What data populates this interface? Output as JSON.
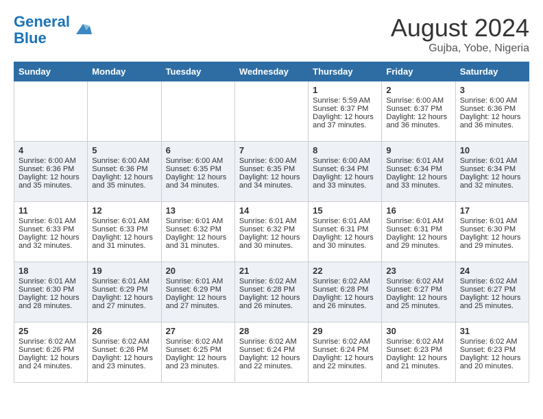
{
  "header": {
    "logo_line1": "General",
    "logo_line2": "Blue",
    "month_title": "August 2024",
    "location": "Gujba, Yobe, Nigeria"
  },
  "weekdays": [
    "Sunday",
    "Monday",
    "Tuesday",
    "Wednesday",
    "Thursday",
    "Friday",
    "Saturday"
  ],
  "weeks": [
    [
      {
        "day": "",
        "content": ""
      },
      {
        "day": "",
        "content": ""
      },
      {
        "day": "",
        "content": ""
      },
      {
        "day": "",
        "content": ""
      },
      {
        "day": "1",
        "content": "Sunrise: 5:59 AM\nSunset: 6:37 PM\nDaylight: 12 hours\nand 37 minutes."
      },
      {
        "day": "2",
        "content": "Sunrise: 6:00 AM\nSunset: 6:37 PM\nDaylight: 12 hours\nand 36 minutes."
      },
      {
        "day": "3",
        "content": "Sunrise: 6:00 AM\nSunset: 6:36 PM\nDaylight: 12 hours\nand 36 minutes."
      }
    ],
    [
      {
        "day": "4",
        "content": "Sunrise: 6:00 AM\nSunset: 6:36 PM\nDaylight: 12 hours\nand 35 minutes."
      },
      {
        "day": "5",
        "content": "Sunrise: 6:00 AM\nSunset: 6:36 PM\nDaylight: 12 hours\nand 35 minutes."
      },
      {
        "day": "6",
        "content": "Sunrise: 6:00 AM\nSunset: 6:35 PM\nDaylight: 12 hours\nand 34 minutes."
      },
      {
        "day": "7",
        "content": "Sunrise: 6:00 AM\nSunset: 6:35 PM\nDaylight: 12 hours\nand 34 minutes."
      },
      {
        "day": "8",
        "content": "Sunrise: 6:00 AM\nSunset: 6:34 PM\nDaylight: 12 hours\nand 33 minutes."
      },
      {
        "day": "9",
        "content": "Sunrise: 6:01 AM\nSunset: 6:34 PM\nDaylight: 12 hours\nand 33 minutes."
      },
      {
        "day": "10",
        "content": "Sunrise: 6:01 AM\nSunset: 6:34 PM\nDaylight: 12 hours\nand 32 minutes."
      }
    ],
    [
      {
        "day": "11",
        "content": "Sunrise: 6:01 AM\nSunset: 6:33 PM\nDaylight: 12 hours\nand 32 minutes."
      },
      {
        "day": "12",
        "content": "Sunrise: 6:01 AM\nSunset: 6:33 PM\nDaylight: 12 hours\nand 31 minutes."
      },
      {
        "day": "13",
        "content": "Sunrise: 6:01 AM\nSunset: 6:32 PM\nDaylight: 12 hours\nand 31 minutes."
      },
      {
        "day": "14",
        "content": "Sunrise: 6:01 AM\nSunset: 6:32 PM\nDaylight: 12 hours\nand 30 minutes."
      },
      {
        "day": "15",
        "content": "Sunrise: 6:01 AM\nSunset: 6:31 PM\nDaylight: 12 hours\nand 30 minutes."
      },
      {
        "day": "16",
        "content": "Sunrise: 6:01 AM\nSunset: 6:31 PM\nDaylight: 12 hours\nand 29 minutes."
      },
      {
        "day": "17",
        "content": "Sunrise: 6:01 AM\nSunset: 6:30 PM\nDaylight: 12 hours\nand 29 minutes."
      }
    ],
    [
      {
        "day": "18",
        "content": "Sunrise: 6:01 AM\nSunset: 6:30 PM\nDaylight: 12 hours\nand 28 minutes."
      },
      {
        "day": "19",
        "content": "Sunrise: 6:01 AM\nSunset: 6:29 PM\nDaylight: 12 hours\nand 27 minutes."
      },
      {
        "day": "20",
        "content": "Sunrise: 6:01 AM\nSunset: 6:29 PM\nDaylight: 12 hours\nand 27 minutes."
      },
      {
        "day": "21",
        "content": "Sunrise: 6:02 AM\nSunset: 6:28 PM\nDaylight: 12 hours\nand 26 minutes."
      },
      {
        "day": "22",
        "content": "Sunrise: 6:02 AM\nSunset: 6:28 PM\nDaylight: 12 hours\nand 26 minutes."
      },
      {
        "day": "23",
        "content": "Sunrise: 6:02 AM\nSunset: 6:27 PM\nDaylight: 12 hours\nand 25 minutes."
      },
      {
        "day": "24",
        "content": "Sunrise: 6:02 AM\nSunset: 6:27 PM\nDaylight: 12 hours\nand 25 minutes."
      }
    ],
    [
      {
        "day": "25",
        "content": "Sunrise: 6:02 AM\nSunset: 6:26 PM\nDaylight: 12 hours\nand 24 minutes."
      },
      {
        "day": "26",
        "content": "Sunrise: 6:02 AM\nSunset: 6:26 PM\nDaylight: 12 hours\nand 23 minutes."
      },
      {
        "day": "27",
        "content": "Sunrise: 6:02 AM\nSunset: 6:25 PM\nDaylight: 12 hours\nand 23 minutes."
      },
      {
        "day": "28",
        "content": "Sunrise: 6:02 AM\nSunset: 6:24 PM\nDaylight: 12 hours\nand 22 minutes."
      },
      {
        "day": "29",
        "content": "Sunrise: 6:02 AM\nSunset: 6:24 PM\nDaylight: 12 hours\nand 22 minutes."
      },
      {
        "day": "30",
        "content": "Sunrise: 6:02 AM\nSunset: 6:23 PM\nDaylight: 12 hours\nand 21 minutes."
      },
      {
        "day": "31",
        "content": "Sunrise: 6:02 AM\nSunset: 6:23 PM\nDaylight: 12 hours\nand 20 minutes."
      }
    ]
  ]
}
